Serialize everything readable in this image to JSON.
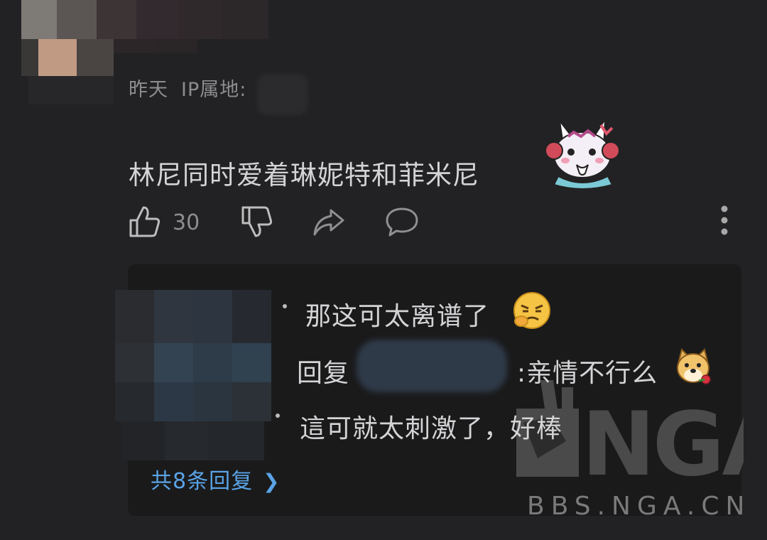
{
  "comment": {
    "time": "昨天",
    "ip_label": "IP属地:",
    "text": "林尼同时爱着琳妮特和菲米尼",
    "sticker": "bunny-sticker",
    "like_count": "30"
  },
  "actions": [
    "like-icon",
    "dislike-icon",
    "share-icon",
    "comment-icon",
    "more-icon"
  ],
  "replies": [
    {
      "text": "那这可太离谱了",
      "emoji": "tsundere-emoji"
    },
    {
      "prefix": "回复",
      "text": ":亲情不行么",
      "emoji": "doge-rose-emoji"
    },
    {
      "text": "這可就太刺激了，好棒"
    }
  ],
  "total_replies": "共8条回复",
  "watermark": {
    "logo": "NGA",
    "url": "BBS.NGA.CN"
  },
  "colors": {
    "background": "#222224",
    "reply_background": "#1a1a1b",
    "link": "#5aa3e6"
  }
}
